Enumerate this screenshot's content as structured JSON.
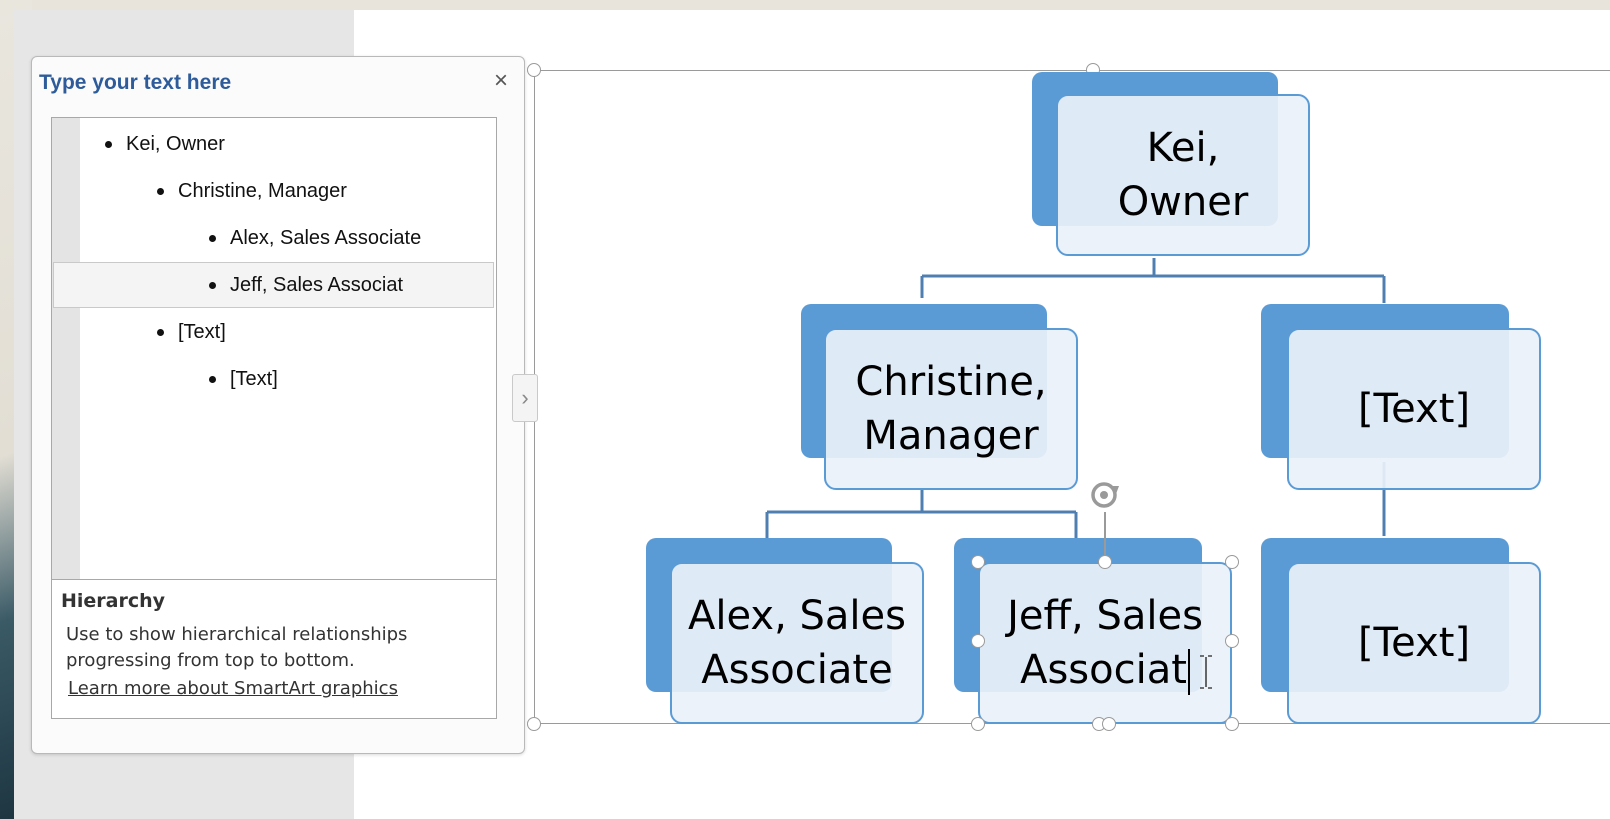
{
  "text_pane": {
    "title": "Type your text here",
    "close_icon": "close-icon",
    "items": [
      {
        "label": "Kei, Owner",
        "level": 1
      },
      {
        "label": "Christine, Manager",
        "level": 2
      },
      {
        "label": "Alex, Sales Associate",
        "level": 3
      },
      {
        "label": "Jeff, Sales Associat",
        "level": 3,
        "selected": true
      },
      {
        "label": "[Text]",
        "level": 2
      },
      {
        "label": "[Text]",
        "level": 3
      }
    ],
    "layout_name": "Hierarchy",
    "layout_description": "Use to show hierarchical relationships progressing from top to bottom.",
    "learn_more_link": "Learn more about SmartArt graphics"
  },
  "expand_icon": "chevron-right-icon",
  "diagram": {
    "shapes": {
      "kei": {
        "line1": "Kei,",
        "line2": "Owner"
      },
      "christine": {
        "line1": "Christine,",
        "line2": "Manager"
      },
      "text_right": {
        "line1": "[Text]",
        "line2": ""
      },
      "alex": {
        "line1": "Alex, Sales",
        "line2": "Associate"
      },
      "jeff": {
        "line1": "Jeff, Sales",
        "line2": "Associat"
      },
      "text_bottom": {
        "line1": "[Text]",
        "line2": ""
      }
    },
    "accent_color": "#5b9bd5",
    "rotate_icon": "rotate-icon",
    "cursor_icon": "i-beam-cursor-icon"
  }
}
